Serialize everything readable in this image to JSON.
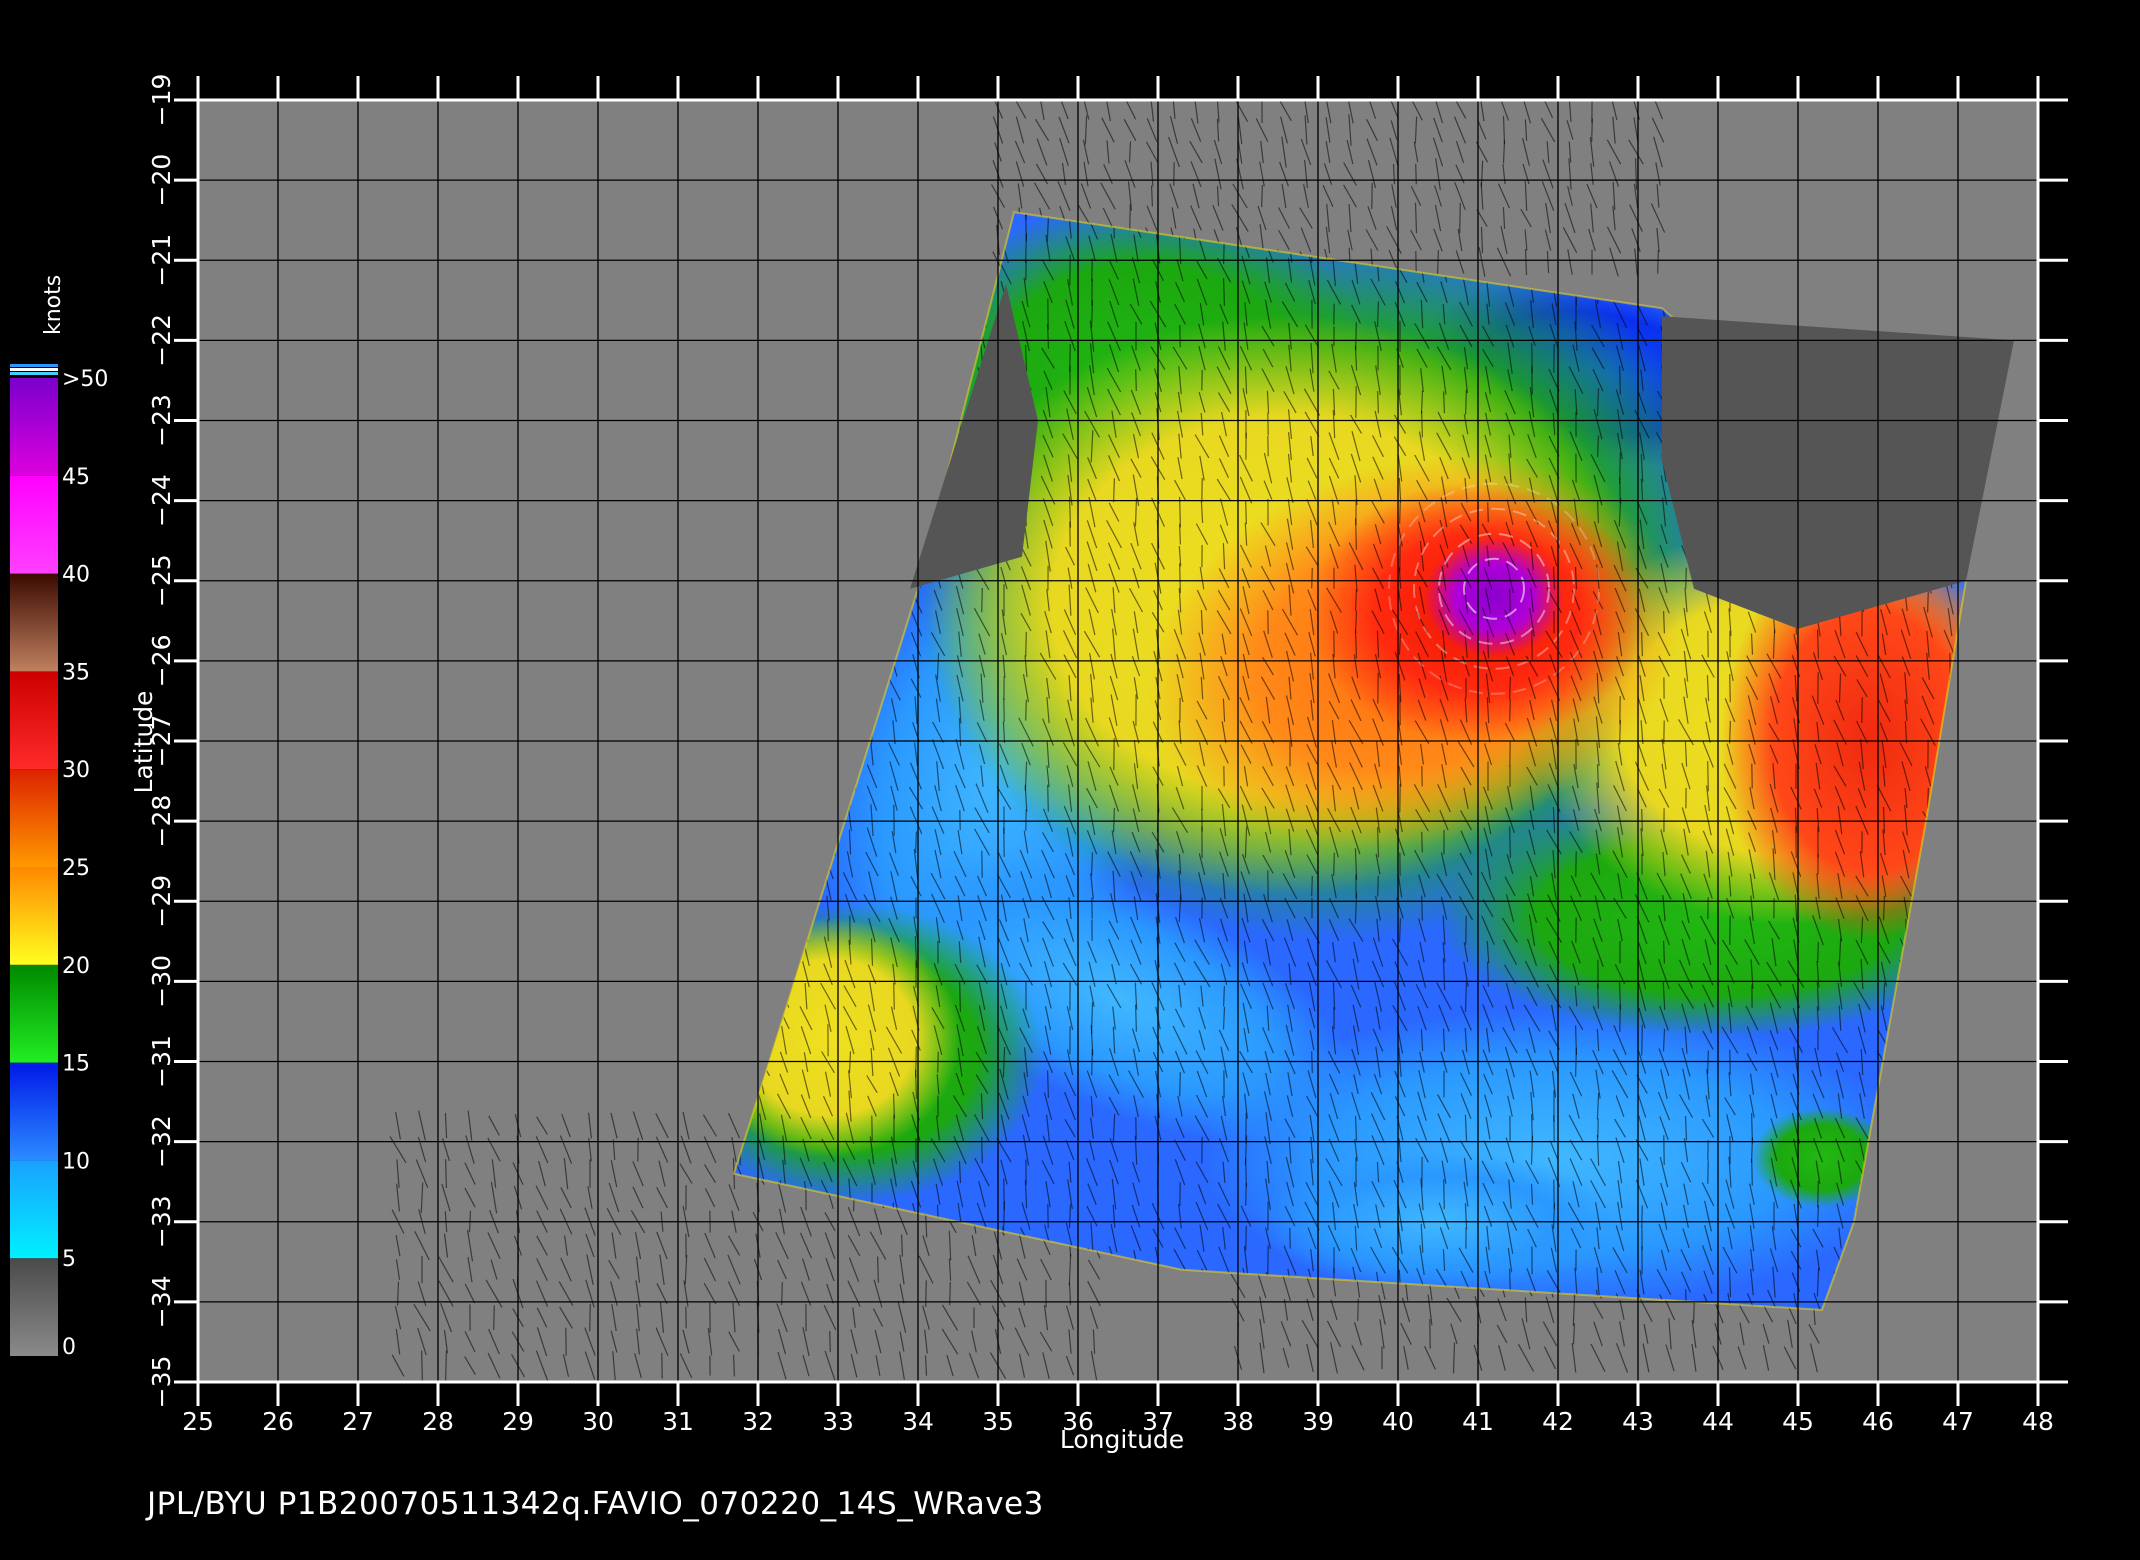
{
  "footer": "JPL/BYU  P1B20070511342q.FAVIO_070220_14S_WRave3",
  "colorbar": {
    "unit": "knots",
    "labels": [
      "0",
      "5",
      "10",
      "15",
      "20",
      "25",
      "30",
      "35",
      "40",
      "45",
      ">50"
    ],
    "bands": [
      {
        "from": 0,
        "to": 5,
        "top": "#4a4a4a",
        "bottom": "#8a8a8a"
      },
      {
        "from": 5,
        "to": 10,
        "top": "#1aa0ff",
        "bottom": "#00f0ff"
      },
      {
        "from": 10,
        "to": 15,
        "top": "#0018e8",
        "bottom": "#2b8cff"
      },
      {
        "from": 15,
        "to": 20,
        "top": "#008800",
        "bottom": "#22ee22"
      },
      {
        "from": 20,
        "to": 25,
        "top": "#ff8800",
        "bottom": "#ffff20"
      },
      {
        "from": 25,
        "to": 30,
        "top": "#dd2200",
        "bottom": "#ff9900"
      },
      {
        "from": 30,
        "to": 35,
        "top": "#cc0000",
        "bottom": "#ff2a2a"
      },
      {
        "from": 35,
        "to": 40,
        "top": "#3a0a00",
        "bottom": "#c08060"
      },
      {
        "from": 40,
        "to": 45,
        "top": "#ff00ff",
        "bottom": "#ff40ff"
      },
      {
        "from": 45,
        "to": 50,
        "top": "#7a00cc",
        "bottom": "#dd00dd"
      }
    ]
  },
  "chart_data": {
    "type": "heatmap",
    "title": "",
    "xlabel": "Longitude",
    "ylabel": "Latitude",
    "xlim": [
      25,
      48
    ],
    "ylim": [
      -35,
      -19
    ],
    "xticks": [
      25,
      26,
      27,
      28,
      29,
      30,
      31,
      32,
      33,
      34,
      35,
      36,
      37,
      38,
      39,
      40,
      41,
      42,
      43,
      44,
      45,
      46,
      47,
      48
    ],
    "yticks": [
      -19,
      -20,
      -21,
      -22,
      -23,
      -24,
      -25,
      -26,
      -27,
      -28,
      -29,
      -30,
      -31,
      -32,
      -33,
      -34,
      -35
    ],
    "grid": true,
    "colorbar_unit": "knots",
    "colorbar_range": [
      0,
      50
    ],
    "background_color": "#808080",
    "no_data_color": "#555555",
    "swath_outline_lonlat": [
      [
        35.2,
        -20.4
      ],
      [
        43.3,
        -21.6
      ],
      [
        47.1,
        -25.0
      ],
      [
        46.6,
        -28.0
      ],
      [
        45.7,
        -33.0
      ],
      [
        45.3,
        -34.1
      ],
      [
        37.3,
        -33.6
      ],
      [
        31.7,
        -32.4
      ],
      [
        34.0,
        -25.1
      ],
      [
        35.2,
        -20.4
      ]
    ],
    "no_data_regions_lonlat": [
      [
        [
          35.1,
          -21.3
        ],
        [
          33.9,
          -25.1
        ],
        [
          35.3,
          -24.7
        ],
        [
          35.5,
          -23.0
        ]
      ],
      [
        [
          43.3,
          -21.7
        ],
        [
          47.7,
          -22.0
        ],
        [
          47.1,
          -25.0
        ],
        [
          45.0,
          -25.6
        ],
        [
          43.7,
          -25.1
        ],
        [
          43.3,
          -23.5
        ]
      ]
    ],
    "wind_speed_regions": [
      {
        "name": "storm_core",
        "center_lon": 41.2,
        "center_lat": -25.2,
        "speed_knots": 45
      },
      {
        "name": "inner_ring",
        "center_lon": 41.0,
        "center_lat": -25.4,
        "speed_knots": 33
      },
      {
        "name": "outer_ring",
        "center_lon": 40.2,
        "center_lat": -25.9,
        "speed_knots": 27
      },
      {
        "name": "east_band",
        "center_lon": 45.8,
        "center_lat": -26.8,
        "speed_knots": 28
      },
      {
        "name": "north_band",
        "center_lon": 37.5,
        "center_lat": -23.2,
        "speed_knots": 22
      },
      {
        "name": "southwest_patch",
        "center_lon": 33.5,
        "center_lat": -30.8,
        "speed_knots": 21
      },
      {
        "name": "west_channel",
        "center_lon": 35.2,
        "center_lat": -27.6,
        "speed_knots": 9
      },
      {
        "name": "south_band",
        "center_lon": 41.0,
        "center_lat": -32.2,
        "speed_knots": 11
      },
      {
        "name": "northeast_channel",
        "center_lon": 42.0,
        "center_lat": -22.4,
        "speed_knots": 12
      }
    ]
  }
}
